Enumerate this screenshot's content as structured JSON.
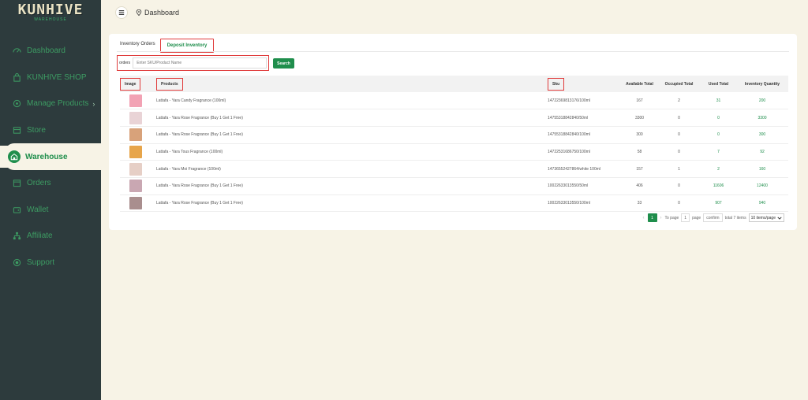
{
  "brand": {
    "logo_text": "KUNHIVE",
    "logo_sub": "WAREHOUSE"
  },
  "sidebar": {
    "items": [
      {
        "label": "Dashboard",
        "icon": "dashboard-icon"
      },
      {
        "label": "KUNHIVE SHOP",
        "icon": "shop-icon"
      },
      {
        "label": "Manage Products",
        "icon": "products-icon",
        "chevron": "›"
      },
      {
        "label": "Store",
        "icon": "store-icon"
      },
      {
        "label": "Warehouse",
        "icon": "warehouse-icon",
        "active": true
      },
      {
        "label": "Orders",
        "icon": "orders-icon"
      },
      {
        "label": "Wallet",
        "icon": "wallet-icon"
      },
      {
        "label": "Affiliate",
        "icon": "affiliate-icon"
      },
      {
        "label": "Support",
        "icon": "support-icon"
      }
    ]
  },
  "header": {
    "breadcrumb": "Dashboard"
  },
  "tabs": [
    {
      "label": "Inventory Orders"
    },
    {
      "label": "Deposit Inventory",
      "active": true
    }
  ],
  "filter": {
    "label": "orders",
    "placeholder": "Enter SKU/Product Name",
    "search_label": "Search"
  },
  "table": {
    "columns": [
      "Image",
      "Products",
      "Sku",
      "Available Total",
      "Occupied Total",
      "Used Total",
      "Inventory Quantity"
    ],
    "rows": [
      {
        "product": "Lattafa - Yara Candy Fragrance (100ml)",
        "sku": "14722369813176/100ml",
        "available": "167",
        "occupied": "2",
        "used": "31",
        "quantity": "200",
        "thumb_color": "#f2a2b4"
      },
      {
        "product": "Lattafa - Yara Rose Fragrance (Buy 1 Get 1 Free)",
        "sku": "14755318842840/50ml",
        "available": "3300",
        "occupied": "0",
        "used": "0",
        "quantity": "3300",
        "thumb_color": "#e9d3d6"
      },
      {
        "product": "Lattafa - Yara Rose Fragrance (Buy 1 Get 1 Free)",
        "sku": "14755318842840/100ml",
        "available": "300",
        "occupied": "0",
        "used": "0",
        "quantity": "300",
        "thumb_color": "#d8a27a"
      },
      {
        "product": "Lattafa - Yara Tous Fragrance (100ml)",
        "sku": "14722531686750/100ml",
        "available": "58",
        "occupied": "0",
        "used": "7",
        "quantity": "92",
        "thumb_color": "#e7a54a"
      },
      {
        "product": "Lattafa - Yara Moi Fragrance (100ml)",
        "sku": "14736552427864/white 100ml",
        "available": "157",
        "occupied": "1",
        "used": "2",
        "quantity": "160",
        "thumb_color": "#e6cfc6"
      },
      {
        "product": "Lattafa - Yara Rose Fragrance (Buy 1 Get 1 Free)",
        "sku": "10022633013550/50ml",
        "available": "406",
        "occupied": "0",
        "used": "11606",
        "quantity": "12400",
        "thumb_color": "#c9a7b2"
      },
      {
        "product": "Lattafa - Yara Rose Fragrance (Buy 1 Get 1 Free)",
        "sku": "10022633013550/100ml",
        "available": "33",
        "occupied": "0",
        "used": "907",
        "quantity": "940",
        "thumb_color": "#a98e8e"
      }
    ]
  },
  "pagination": {
    "current_page": "1",
    "to_page_label": "To page",
    "page_value": "1",
    "page_label": "page",
    "confirm_label": "confirm",
    "total_label": "total 7 items",
    "per_page": "10 items/page"
  }
}
